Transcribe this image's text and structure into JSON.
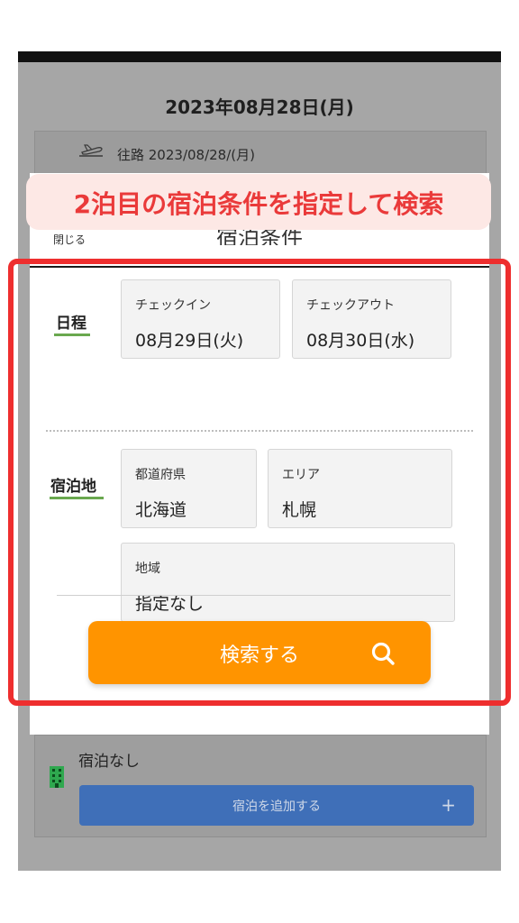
{
  "page": {
    "date_title": "2023年08月28日(月)",
    "outbound_label": "往路 2023/08/28/(月)"
  },
  "modal": {
    "close_label": "閉じる",
    "title": "宿泊条件",
    "schedule_label": "日程",
    "checkin": {
      "label": "チェックイン",
      "value": "08月29日(火)"
    },
    "checkout": {
      "label": "チェックアウト",
      "value": "08月30日(水)"
    },
    "lodging_label": "宿泊地",
    "prefecture": {
      "label": "都道府県",
      "value": "北海道"
    },
    "area": {
      "label": "エリア",
      "value": "札幌"
    },
    "region": {
      "label": "地域",
      "value": "指定なし"
    },
    "search_label": "検索する"
  },
  "lower": {
    "no_stay_label": "宿泊なし",
    "add_stay_label": "宿泊を追加する",
    "add_stay_plus": "+"
  },
  "annotation": {
    "banner_text": "2泊目の宿泊条件を指定して検索",
    "highlight_color": "#ee2e2e"
  },
  "colors": {
    "accent_orange": "#ff9400",
    "schedule_green": "#6aa84f",
    "add_blue": "#3f6fb8"
  },
  "icons": {
    "plane": "plane-icon",
    "search": "search-icon",
    "hotel": "hotel-icon"
  }
}
